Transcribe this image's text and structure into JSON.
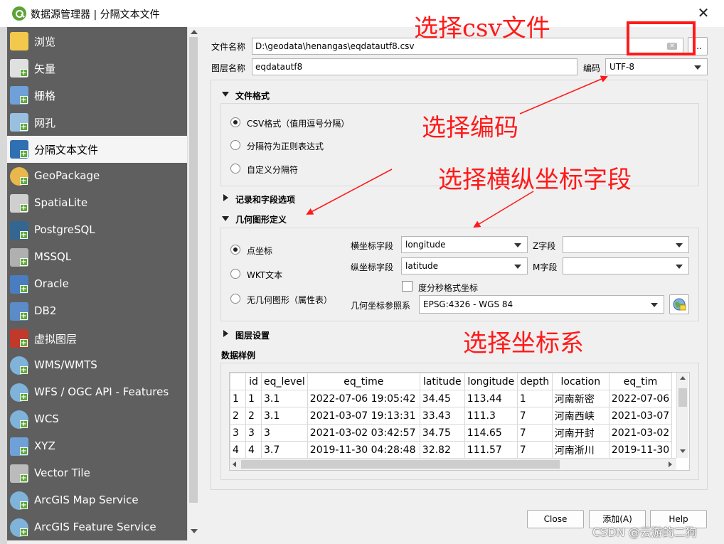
{
  "window": {
    "title": "数据源管理器 | 分隔文本文件"
  },
  "sidebar": {
    "items": [
      {
        "label": "浏览",
        "icon": "folder-icon"
      },
      {
        "label": "矢量",
        "icon": "vector-icon"
      },
      {
        "label": "栅格",
        "icon": "raster-icon"
      },
      {
        "label": "网孔",
        "icon": "mesh-icon"
      },
      {
        "label": "分隔文本文件",
        "icon": "delimited-text-icon"
      },
      {
        "label": "GeoPackage",
        "icon": "geopackage-icon"
      },
      {
        "label": "SpatiaLite",
        "icon": "spatialite-icon"
      },
      {
        "label": "PostgreSQL",
        "icon": "postgresql-icon"
      },
      {
        "label": "MSSQL",
        "icon": "mssql-icon"
      },
      {
        "label": "Oracle",
        "icon": "oracle-icon"
      },
      {
        "label": "DB2",
        "icon": "db2-icon"
      },
      {
        "label": "虚拟图层",
        "icon": "virtual-layer-icon"
      },
      {
        "label": "WMS/WMTS",
        "icon": "wms-icon"
      },
      {
        "label": "WFS / OGC API - Features",
        "icon": "wfs-icon"
      },
      {
        "label": "WCS",
        "icon": "wcs-icon"
      },
      {
        "label": "XYZ",
        "icon": "xyz-icon"
      },
      {
        "label": "Vector Tile",
        "icon": "vector-tile-icon"
      },
      {
        "label": "ArcGIS Map Service",
        "icon": "arcgis-map-icon"
      },
      {
        "label": "ArcGIS Feature Service",
        "icon": "arcgis-feature-icon"
      }
    ],
    "selected": "分隔文本文件"
  },
  "form": {
    "file_label": "文件名称",
    "file_value": "D:\\geodata\\henangas\\eqdatautf8.csv",
    "browse_label": "...",
    "layer_label": "图层名称",
    "layer_value": "eqdatautf8",
    "encoding_label": "编码",
    "encoding_value": "UTF-8"
  },
  "file_format": {
    "title": "文件格式",
    "options": [
      "CSV格式（值用逗号分隔）",
      "分隔符为正则表达式",
      "自定义分隔符"
    ],
    "selected": "CSV格式（值用逗号分隔）"
  },
  "record_options": {
    "title": "记录和字段选项"
  },
  "geometry": {
    "title": "几何图形定义",
    "options": [
      "点坐标",
      "WKT文本",
      "无几何图形（属性表）"
    ],
    "selected": "点坐标",
    "x_label": "横坐标字段",
    "x_value": "longitude",
    "y_label": "纵坐标字段",
    "y_value": "latitude",
    "z_label": "Z字段",
    "z_value": "",
    "m_label": "M字段",
    "m_value": "",
    "dms_label": "度分秒格式坐标",
    "crs_label": "几何坐标参照系",
    "crs_value": "EPSG:4326 - WGS 84"
  },
  "layer_settings": {
    "title": "图层设置"
  },
  "sample": {
    "title": "数据样例",
    "columns": [
      "id",
      "eq_level",
      "eq_time",
      "latitude",
      "longitude",
      "depth",
      "location",
      "eq_tim"
    ],
    "rows": [
      {
        "num": "1",
        "cells": [
          "1",
          "3.1",
          "2022-07-06 19:05:42",
          "34.45",
          "113.44",
          "1",
          "河南新密",
          "2022-07-06"
        ]
      },
      {
        "num": "2",
        "cells": [
          "2",
          "3.1",
          "2021-03-07 19:13:31",
          "33.43",
          "111.3",
          "7",
          "河南西峡",
          "2021-03-07"
        ]
      },
      {
        "num": "3",
        "cells": [
          "3",
          "3",
          "2021-03-02 03:42:57",
          "34.75",
          "114.65",
          "7",
          "河南开封",
          "2021-03-02"
        ]
      },
      {
        "num": "4",
        "cells": [
          "4",
          "3.7",
          "2019-11-30 04:28:48",
          "32.82",
          "111.57",
          "7",
          "河南淅川",
          "2019-11-30"
        ]
      }
    ]
  },
  "buttons": {
    "close": "Close",
    "add": "添加(A)",
    "help": "Help"
  },
  "annotations": {
    "select_csv": "选择csv文件",
    "select_encoding": "选择编码",
    "select_xy": "选择横纵坐标字段",
    "select_crs": "选择坐标系",
    "color": "#ff1a1a"
  },
  "watermark": "CSDN @云游的二狗"
}
